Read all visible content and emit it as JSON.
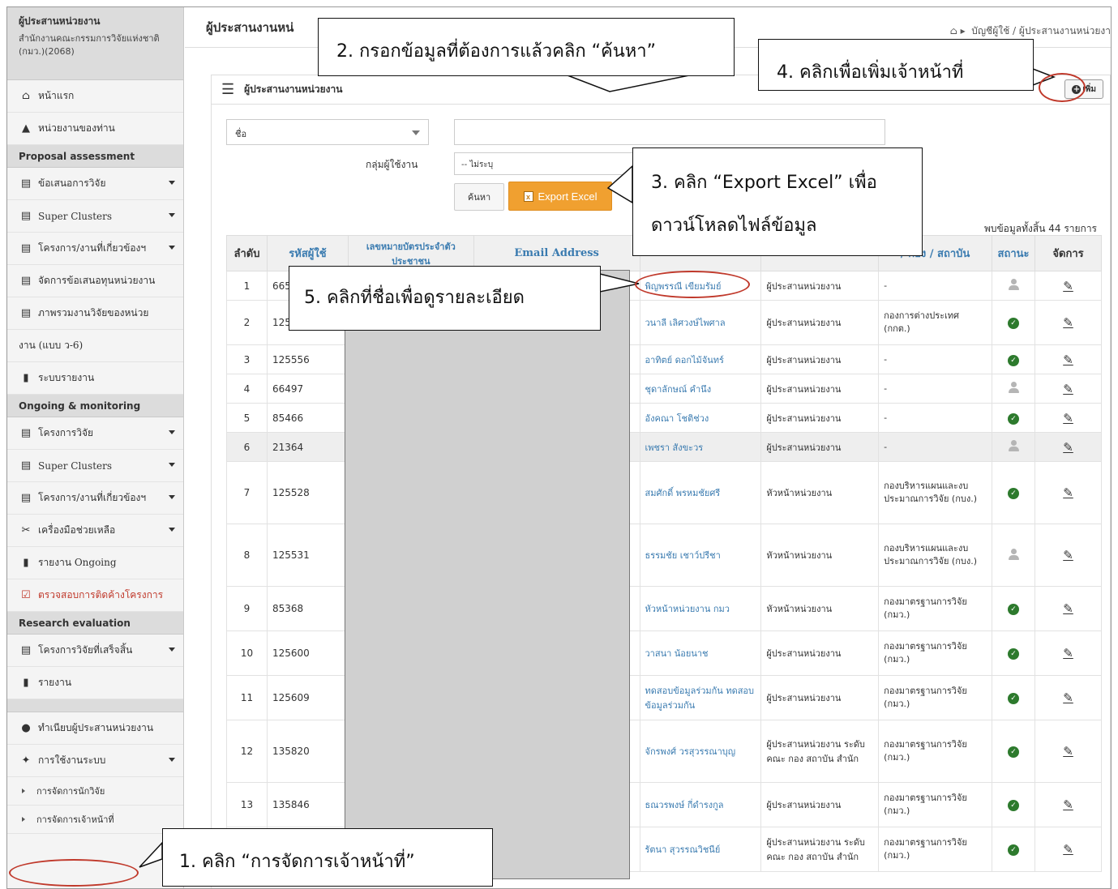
{
  "sidebar": {
    "org_title": "ผู้ประสานหน่วยงาน",
    "org_name": "สำนักงานคณะกรรมการวิจัยแห่งชาติ (กมว.)(2068)",
    "items_top": [
      {
        "label": "หน้าแรก",
        "icon": "home-icon"
      },
      {
        "label": "หน่วยงานของท่าน",
        "icon": "house-icon"
      }
    ],
    "section_proposal": "Proposal assessment",
    "items_proposal": [
      "ข้อเสนอการวิจัย",
      "Super Clusters",
      "โครงการ/งานที่เกี่ยวข้องฯ",
      "จัดการข้อเสนอทุนหน่วยงาน",
      "ภาพรวมงานวิจัยของหน่วย",
      "งาน (แบบ ว-6)",
      "ระบบรายงาน"
    ],
    "section_ongoing": "Ongoing & monitoring",
    "items_ongoing": [
      "โครงการวิจัย",
      "Super Clusters",
      "โครงการ/งานที่เกี่ยวข้องฯ",
      "เครื่องมือช่วยเหลือ",
      "รายงาน Ongoing",
      "ตรวจสอบการติดค้างโครงการ"
    ],
    "section_evaluation": "Research evaluation",
    "items_evaluation": [
      "โครงการวิจัยที่เสร็จสิ้น",
      "รายงาน"
    ],
    "items_bottom": [
      "ทำเนียบผู้ประสานหน่วยงาน",
      "การใช้งานระบบ"
    ],
    "sub_items": [
      "การจัดการนักวิจัย",
      "การจัดการเจ้าหน้าที่"
    ]
  },
  "header": {
    "page_title": "ผู้ประสานงานหน่",
    "breadcrumb": "บัญชีผู้ใช้ / ผู้ประสานงานหน่วยงา"
  },
  "panel": {
    "title": "ผู้ประสานงานหน่วยงาน",
    "add_label": "เพิ่ม",
    "filter_field": "ชื่อ",
    "group_label": "กลุ่มผู้ใช้งาน",
    "group_value": "-- ไม่ระบุ",
    "search_label": "ค้นหา",
    "export_label": "Export Excel",
    "count_text": "พบข้อมูลทั้งสิ้น 44 รายการ"
  },
  "table": {
    "headers": [
      "ลำดับ",
      "รหัสผู้ใช้",
      "เลขหมายบัตรประจำตัวประชาชน",
      "Email Address",
      "",
      "",
      "/ กอง / สถาบัน",
      "สถานะ",
      "จัดการ"
    ],
    "rows": [
      {
        "no": "1",
        "id": "665",
        "name": "พิญพรรณี เขียมรัมย์",
        "role": "ผู้ประสานหน่วยงาน",
        "dept": "-",
        "status": "off"
      },
      {
        "no": "2",
        "id": "125",
        "name": "วนาลี เลิศวงษ์ไพศาล",
        "role": "ผู้ประสานหน่วยงาน",
        "dept": "กองการต่างประเทศ (กกต.)",
        "status": "ok"
      },
      {
        "no": "3",
        "id": "125556",
        "name": "อาทิตย์ ดอกไม้จันทร์",
        "role": "ผู้ประสานหน่วยงาน",
        "dept": "-",
        "status": "ok"
      },
      {
        "no": "4",
        "id": "66497",
        "name": "ชุดาลักษณ์ คำนึง",
        "role": "ผู้ประสานหน่วยงาน",
        "dept": "-",
        "status": "off"
      },
      {
        "no": "5",
        "id": "85466",
        "name": "อังคณา โชติช่วง",
        "role": "ผู้ประสานหน่วยงาน",
        "dept": "-",
        "status": "ok"
      },
      {
        "no": "6",
        "id": "21364",
        "name": "เพชรา สังขะวร",
        "role": "ผู้ประสานหน่วยงาน",
        "dept": "-",
        "status": "off"
      },
      {
        "no": "7",
        "id": "125528",
        "name": "สมศักดิ์ พรหมชัยศรี",
        "role": "หัวหน้าหน่วยงาน",
        "dept": "กองบริหารแผนและงบประมาณการวิจัย (กบง.)",
        "status": "ok"
      },
      {
        "no": "8",
        "id": "125531",
        "name": "ธรรมชัย เชาว์ปรีชา",
        "role": "หัวหน้าหน่วยงาน",
        "dept": "กองบริหารแผนและงบประมาณการวิจัย (กบง.)",
        "status": "off"
      },
      {
        "no": "9",
        "id": "85368",
        "name": "หัวหน้าหน่วยงาน กมว",
        "role": "หัวหน้าหน่วยงาน",
        "dept": "กองมาตรฐานการวิจัย (กมว.)",
        "status": "ok"
      },
      {
        "no": "10",
        "id": "125600",
        "name": "วาสนา น้อยนาช",
        "role": "ผู้ประสานหน่วยงาน",
        "dept": "กองมาตรฐานการวิจัย (กมว.)",
        "status": "ok"
      },
      {
        "no": "11",
        "id": "125609",
        "name": "ทดสอบข้อมูลร่วมกัน ทดสอบข้อมูลร่วมกัน",
        "role": "ผู้ประสานหน่วยงาน",
        "dept": "กองมาตรฐานการวิจัย (กมว.)",
        "status": "ok"
      },
      {
        "no": "12",
        "id": "135820",
        "name": "จักรพงศ์ วรสุวรรณาบุญ",
        "role": "ผู้ประสานหน่วยงาน ระดับ คณะ กอง สถาบัน สำนัก",
        "dept": "กองมาตรฐานการวิจัย (กมว.)",
        "status": "ok"
      },
      {
        "no": "13",
        "id": "135846",
        "name": "ธณวรพงษ์ กี่ดำรงกูล",
        "role": "ผู้ประสานหน่วยงาน",
        "dept": "กองมาตรฐานการวิจัย (กมว.)",
        "status": "ok"
      },
      {
        "no": "",
        "id": "",
        "name": "รัตนา สุวรรณวิชนีย์",
        "role": "ผู้ประสานหน่วยงาน ระดับ คณะ กอง สถาบัน สำนัก",
        "dept": "กองมาตรฐานการวิจัย (กมว.)",
        "status": "ok"
      }
    ]
  },
  "callouts": {
    "step1": "1. คลิก “การจัดการเจ้าหน้าที่”",
    "step2": "2. กรอกข้อมูลที่ต้องการแล้วคลิก “ค้นหา”",
    "step3_line1": "3. คลิก “Export Excel” เพื่อ",
    "step3_line2": "ดาวน์โหลดไฟล์ข้อมูล",
    "step4": "4. คลิกเพื่อเพิ่มเจ้าหน้าที่",
    "step5": "5. คลิกที่ชื่อเพื่อดูรายละเอียด"
  },
  "colors": {
    "highlight": "#c0392b",
    "export": "#f0a030",
    "link": "#3a7bb0",
    "status_ok": "#2d7a2d"
  }
}
